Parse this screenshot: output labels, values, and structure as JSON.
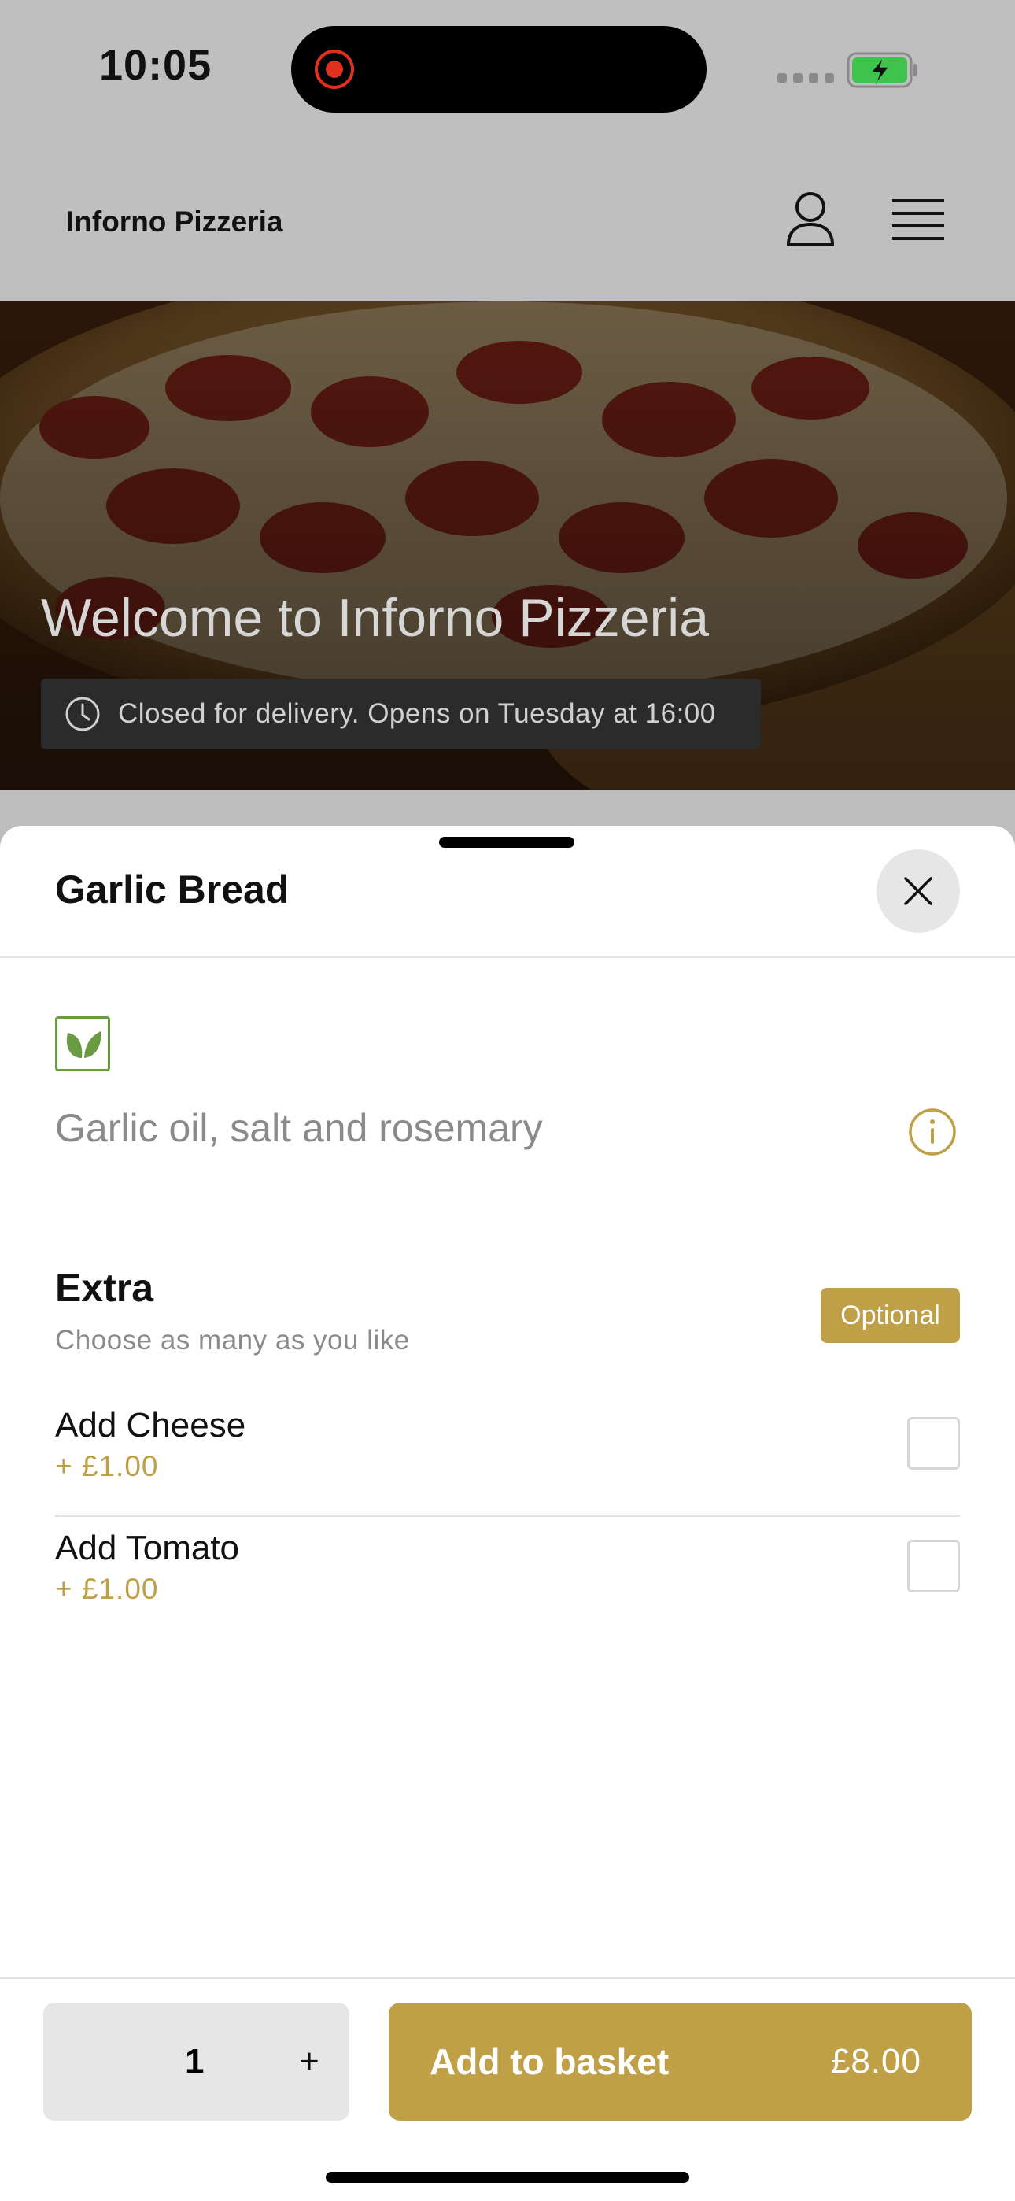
{
  "status_bar": {
    "time": "10:05",
    "recording_icon": "screen-recording-icon",
    "battery_icon": "battery-charging-icon"
  },
  "header": {
    "brand": "Inforno Pizzeria",
    "account_icon": "user-icon",
    "menu_icon": "hamburger-menu-icon"
  },
  "hero": {
    "title": "Welcome to Inforno Pizzeria",
    "status_text": "Closed for delivery. Opens on Tuesday at 16:00",
    "status_icon": "clock-icon"
  },
  "sheet": {
    "title": "Garlic Bread",
    "close_icon": "close-icon",
    "diet_icon": "vegetarian-leaf-icon",
    "description": "Garlic oil, salt and rosemary",
    "info_icon": "info-icon",
    "extras": {
      "title": "Extra",
      "subtitle": "Choose as many as you like",
      "badge": "Optional",
      "options": [
        {
          "name": "Add Cheese",
          "price": "+ £1.00",
          "checked": false
        },
        {
          "name": "Add Tomato",
          "price": "+ £1.00",
          "checked": false
        }
      ]
    }
  },
  "footer": {
    "quantity": "1",
    "plus": "+",
    "add_label": "Add to basket",
    "total": "£8.00"
  },
  "colors": {
    "accent_gold": "#bfa046",
    "veg_green": "#6a9a42",
    "overlay_gray": "#bfbfbf"
  }
}
